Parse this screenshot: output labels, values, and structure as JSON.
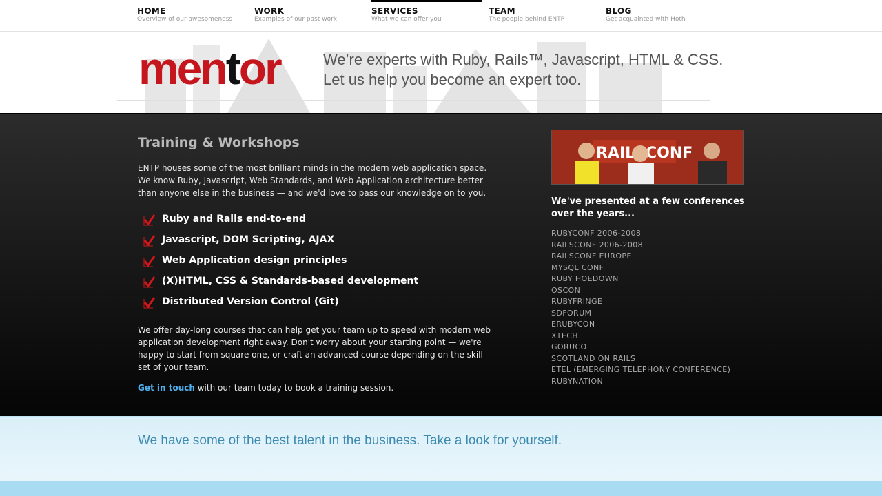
{
  "nav": [
    {
      "label": "HOME",
      "desc": "Overview of our awesomeness"
    },
    {
      "label": "WORK",
      "desc": "Examples of our past work"
    },
    {
      "label": "SERVICES",
      "desc": "What we can offer you"
    },
    {
      "label": "TEAM",
      "desc": "The people behind ENTP"
    },
    {
      "label": "BLOG",
      "desc": "Get acquainted with Hoth"
    }
  ],
  "header": {
    "logo": {
      "part1": "men",
      "part2": "t",
      "part3": "or"
    },
    "tagline1": "We’re experts with Ruby, Rails™, Javascript, HTML & CSS.",
    "tagline2": "Let us help you become an expert too."
  },
  "training": {
    "title": "Training & Workshops",
    "intro": [
      "ENTP houses some of the most brilliant minds in the modern web application space.",
      "We know Ruby, Javascript, Web Standards, and Web Application architecture better",
      "than anyone else in the business — and we'd love to pass our knowledge on to you."
    ],
    "courses": [
      "Ruby and Rails end-to-end",
      "Javascript, DOM Scripting, AJAX",
      "Web Application design principles",
      "(X)HTML, CSS & Standards-based development",
      "Distributed Version Control (Git)"
    ],
    "paragraph": [
      "We offer day-long courses that can help get your team up to speed with modern web",
      "application development right away. Don't worry about your starting point — we're",
      "happy to start from square one, or craft an advanced course depending on the skill-",
      "set of your team."
    ],
    "cta_link": "Get in touch",
    "cta_rest": " with our team today to book a training session."
  },
  "conferences": {
    "photo_banner": "RAILSCONF",
    "heading1": "We've presented at a few conferences",
    "heading2": "over the years...",
    "list": [
      "RUBYCONF 2006-2008",
      "RAILSCONF 2006-2008",
      "RAILSCONF EUROPE",
      "MYSQL CONF",
      "RUBY HOEDOWN",
      "OSCON",
      "RUBYFRINGE",
      "SDFORUM",
      "ERUBYCON",
      "XTECH",
      "GORUCO",
      "SCOTLAND ON RAILS",
      "ETEL (EMERGING TELEPHONY CONFERENCE)",
      "RUBYNATION"
    ]
  },
  "bottom": {
    "text": "We have some of the best talent in the business. Take a look for yourself."
  },
  "colors": {
    "accent_red": "#c4161c",
    "link_blue": "#4fb0ee",
    "bottom_blue": "#3d8ab0",
    "check_red": "#d0161a"
  },
  "icons": {
    "checkmark": "checkmark-icon"
  },
  "active_nav": "SERVICES"
}
